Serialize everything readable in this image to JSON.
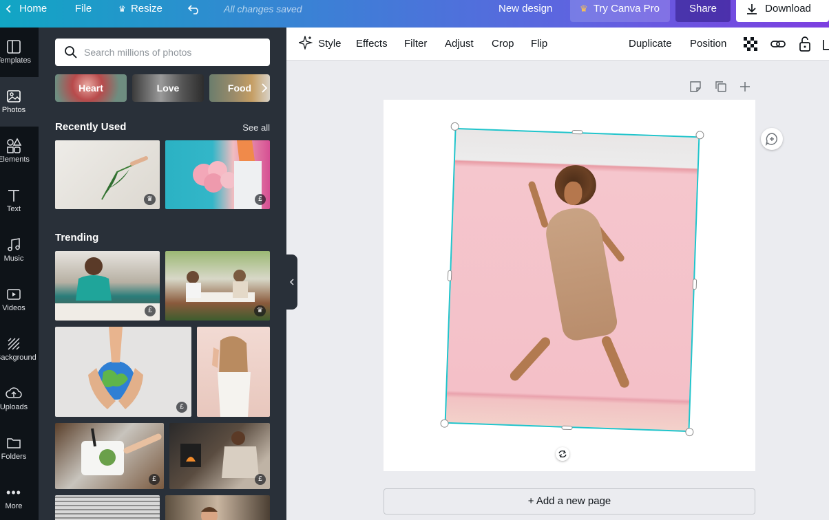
{
  "topbar": {
    "home": "Home",
    "file": "File",
    "resize": "Resize",
    "saved_status": "All changes saved",
    "new_design": "New design",
    "try_pro": "Try Canva Pro",
    "share": "Share",
    "download": "Download"
  },
  "rail": {
    "items": [
      {
        "label": "Templates",
        "icon": "templates-icon"
      },
      {
        "label": "Photos",
        "icon": "photos-icon"
      },
      {
        "label": "Elements",
        "icon": "elements-icon"
      },
      {
        "label": "Text",
        "icon": "text-icon"
      },
      {
        "label": "Music",
        "icon": "music-icon"
      },
      {
        "label": "Videos",
        "icon": "videos-icon"
      },
      {
        "label": "Background",
        "icon": "background-icon"
      },
      {
        "label": "Uploads",
        "icon": "uploads-icon"
      },
      {
        "label": "Folders",
        "icon": "folders-icon"
      },
      {
        "label": "More",
        "icon": "more-icon"
      }
    ],
    "active": "Photos"
  },
  "panel": {
    "search_placeholder": "Search millions of photos",
    "chips": [
      "Heart",
      "Love",
      "Food"
    ],
    "recently_used": "Recently Used",
    "see_all": "See all",
    "trending": "Trending",
    "badges": {
      "crown": "♛",
      "paid": "£"
    }
  },
  "toolbar": {
    "style": "Style",
    "effects": "Effects",
    "filter": "Filter",
    "adjust": "Adjust",
    "crop": "Crop",
    "flip": "Flip",
    "duplicate": "Duplicate",
    "position": "Position"
  },
  "canvas": {
    "add_page": "+ Add a new page"
  },
  "colors": {
    "accent": "#20c4cb",
    "rail_bg": "#0e1318",
    "panel_bg": "#293039"
  }
}
